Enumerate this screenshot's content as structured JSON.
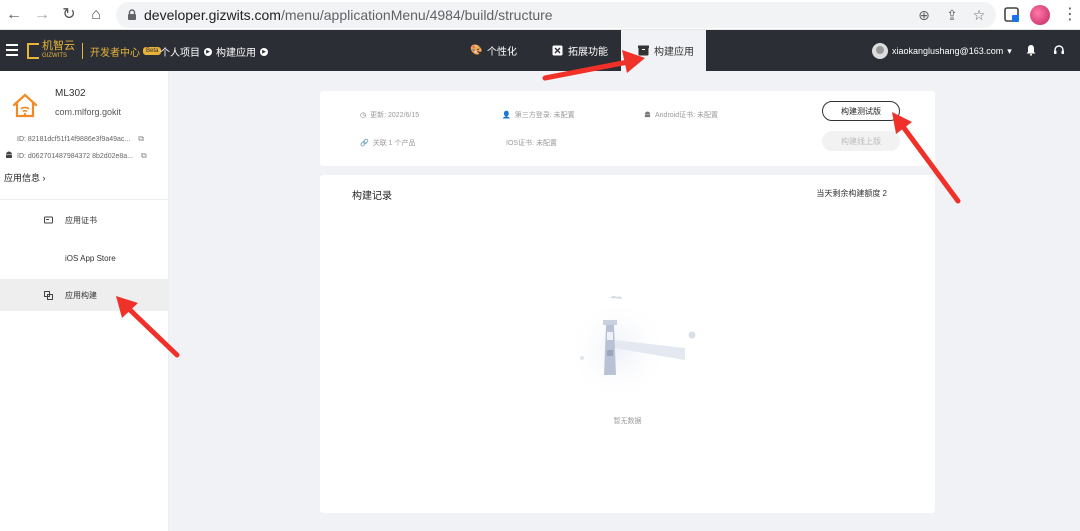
{
  "browser": {
    "url_domain": "developer.gizwits.com",
    "url_path": "/menu/applicationMenu/4984/build/structure"
  },
  "header": {
    "logo_text": "机智云",
    "logo_sub": "GIZWITS",
    "dev_center": "开发者中心",
    "beta": "Beta",
    "crumbs": [
      "个人项目",
      "构建应用"
    ],
    "tabs": [
      {
        "label": "个性化",
        "icon": "palette-icon"
      },
      {
        "label": "拓展功能",
        "icon": "puzzle-icon"
      },
      {
        "label": "构建应用",
        "icon": "box-icon",
        "active": true
      }
    ],
    "user_email": "xiaokanglushang@163.com"
  },
  "sidebar": {
    "app_name": "ML302",
    "app_package": "com.mlforg.gokit",
    "ios_id": "ID: 82181dcf51f14f9886e3f9a49ac...",
    "android_id": "ID: d062701487984372 8b2d02e8a...",
    "app_info": "应用信息",
    "items": [
      {
        "label": "应用证书",
        "icon": "certificate-icon"
      },
      {
        "label": "iOS App Store",
        "icon": "apple-icon"
      },
      {
        "label": "应用构建",
        "icon": "build-icon",
        "active": true
      }
    ]
  },
  "info": {
    "updated": "更新: 2022/6/15",
    "third_party": "第三方登录: 未配置",
    "android_cert": "Android证书: 未配置",
    "linked": "关联 1 个产品",
    "ios_cert": "IOS证书: 未配置",
    "btn_test": "构建测试版",
    "btn_online": "构建线上版"
  },
  "records": {
    "title": "构建记录",
    "quota": "当天剩余构建额度 2",
    "empty": "暂无数据"
  },
  "colors": {
    "header_bg": "#2b2f35",
    "brand_gold": "#e8b33a",
    "arrow_red": "#f0312a"
  }
}
